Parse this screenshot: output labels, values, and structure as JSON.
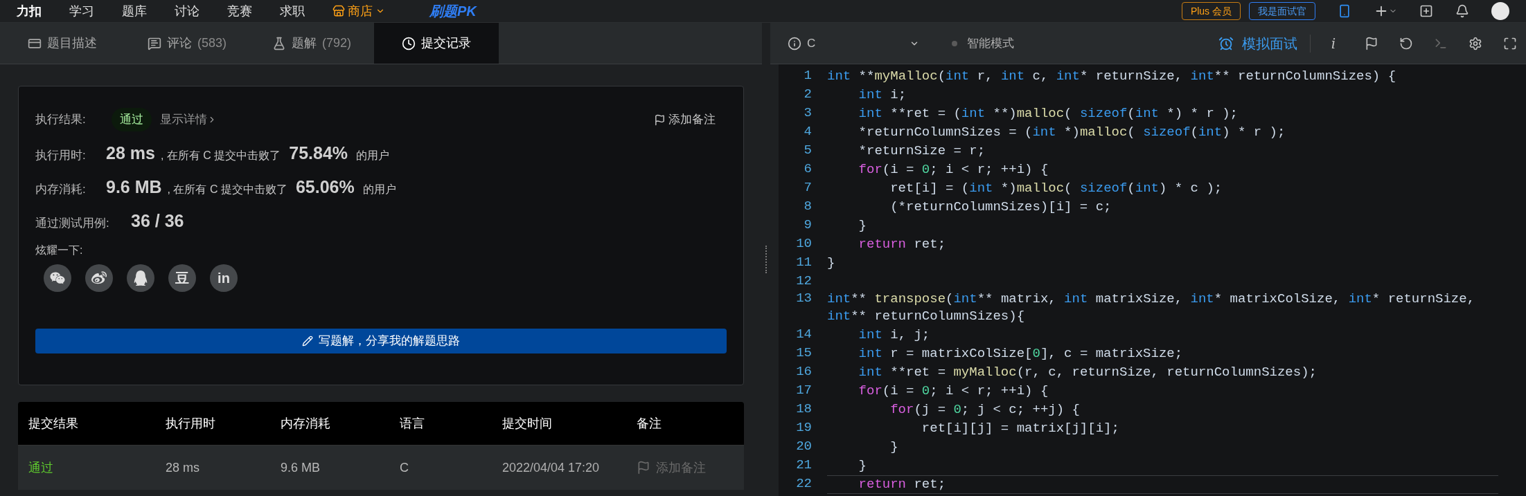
{
  "top_nav": {
    "logo": "力扣",
    "items": [
      {
        "label": "学习",
        "kind": "plain"
      },
      {
        "label": "题库",
        "kind": "plain"
      },
      {
        "label": "讨论",
        "kind": "plain"
      },
      {
        "label": "竞赛",
        "kind": "plain"
      },
      {
        "label": "求职",
        "kind": "plain"
      },
      {
        "label": "商店",
        "kind": "store"
      },
      {
        "label": "刷题PK",
        "kind": "promo"
      }
    ],
    "plus_button": "Plus 会员",
    "interviewer_button": "我是面试官"
  },
  "tabs": [
    {
      "label": "题目描述",
      "selected": false
    },
    {
      "label": "评论",
      "count": "(583)",
      "selected": false
    },
    {
      "label": "题解",
      "count": "(792)",
      "selected": false
    },
    {
      "label": "提交记录",
      "selected": true
    }
  ],
  "result_card": {
    "result_label": "执行结果:",
    "result_status": "通过",
    "details_link": "显示详情",
    "add_note": "添加备注",
    "stats": [
      {
        "label": "执行用时:",
        "value": "28 ms",
        "mid": ", 在所有 C 提交中击败了",
        "percent": "75.84%",
        "suffix": "的用户"
      },
      {
        "label": "内存消耗:",
        "value": "9.6 MB",
        "mid": ", 在所有 C 提交中击败了",
        "percent": "65.06%",
        "suffix": "的用户"
      }
    ],
    "tests_label": "通过测试用例:",
    "tests_value": "36 / 36",
    "share_label": "炫耀一下:",
    "share": [
      {
        "kind": "wechat"
      },
      {
        "kind": "weibo"
      },
      {
        "kind": "qq"
      },
      {
        "kind": "text",
        "text": "豆"
      },
      {
        "kind": "text",
        "text": "in"
      }
    ],
    "write_button": "写题解，分享我的解题思路"
  },
  "submissions": {
    "columns": [
      "提交结果",
      "执行用时",
      "内存消耗",
      "语言",
      "提交时间",
      "备注"
    ],
    "rows": [
      {
        "status": "通过",
        "kind": "accepted",
        "runtime": "28 ms",
        "memory": "9.6 MB",
        "language": "C",
        "time": "2022/04/04 17:20",
        "note": "添加备注"
      }
    ]
  },
  "editor": {
    "language": "C",
    "mode": "智能模式",
    "mock_interview": "模拟面试",
    "info_button": "i",
    "lines": [
      {
        "number": "1",
        "segments": [
          {
            "kind": "kw",
            "text": "int"
          },
          {
            "kind": "p",
            "text": " **"
          },
          {
            "kind": "fn",
            "text": "myMalloc"
          },
          {
            "kind": "p",
            "text": "("
          },
          {
            "kind": "kw",
            "text": "int"
          },
          {
            "kind": "p",
            "text": " r, "
          },
          {
            "kind": "kw",
            "text": "int"
          },
          {
            "kind": "p",
            "text": " c, "
          },
          {
            "kind": "kw",
            "text": "int"
          },
          {
            "kind": "p",
            "text": "* returnSize, "
          },
          {
            "kind": "kw",
            "text": "int"
          },
          {
            "kind": "p",
            "text": "** returnColumnSizes) {"
          }
        ]
      },
      {
        "number": "2",
        "segments": [
          {
            "kind": "kw",
            "text": "    int"
          },
          {
            "kind": "p",
            "text": " i;"
          }
        ]
      },
      {
        "number": "3",
        "segments": [
          {
            "kind": "kw",
            "text": "    int"
          },
          {
            "kind": "p",
            "text": " **ret = ("
          },
          {
            "kind": "kw",
            "text": "int"
          },
          {
            "kind": "p",
            "text": " **)"
          },
          {
            "kind": "fn",
            "text": "malloc"
          },
          {
            "kind": "p",
            "text": "( "
          },
          {
            "kind": "kw",
            "text": "sizeof"
          },
          {
            "kind": "p",
            "text": "("
          },
          {
            "kind": "kw",
            "text": "int"
          },
          {
            "kind": "p",
            "text": " *) * r );"
          }
        ]
      },
      {
        "number": "4",
        "segments": [
          {
            "kind": "p",
            "text": "    *returnColumnSizes = ("
          },
          {
            "kind": "kw",
            "text": "int"
          },
          {
            "kind": "p",
            "text": " *)"
          },
          {
            "kind": "fn",
            "text": "malloc"
          },
          {
            "kind": "p",
            "text": "( "
          },
          {
            "kind": "kw",
            "text": "sizeof"
          },
          {
            "kind": "p",
            "text": "("
          },
          {
            "kind": "kw",
            "text": "int"
          },
          {
            "kind": "p",
            "text": ") * r );"
          }
        ]
      },
      {
        "number": "5",
        "segments": [
          {
            "kind": "p",
            "text": "    *returnSize = r;"
          }
        ]
      },
      {
        "number": "6",
        "segments": [
          {
            "kind": "ctl",
            "text": "    for"
          },
          {
            "kind": "p",
            "text": "(i = "
          },
          {
            "kind": "num",
            "text": "0"
          },
          {
            "kind": "p",
            "text": "; i < r; ++i) {"
          }
        ]
      },
      {
        "number": "7",
        "segments": [
          {
            "kind": "p",
            "text": "        ret[i] = ("
          },
          {
            "kind": "kw",
            "text": "int"
          },
          {
            "kind": "p",
            "text": " *)"
          },
          {
            "kind": "fn",
            "text": "malloc"
          },
          {
            "kind": "p",
            "text": "( "
          },
          {
            "kind": "kw",
            "text": "sizeof"
          },
          {
            "kind": "p",
            "text": "("
          },
          {
            "kind": "kw",
            "text": "int"
          },
          {
            "kind": "p",
            "text": ") * c );"
          }
        ]
      },
      {
        "number": "8",
        "segments": [
          {
            "kind": "p",
            "text": "        (*returnColumnSizes)[i] = c;"
          }
        ]
      },
      {
        "number": "9",
        "segments": [
          {
            "kind": "p",
            "text": "    }"
          }
        ]
      },
      {
        "number": "10",
        "segments": [
          {
            "kind": "ctl",
            "text": "    return"
          },
          {
            "kind": "p",
            "text": " ret;"
          }
        ]
      },
      {
        "number": "11",
        "segments": [
          {
            "kind": "p",
            "text": "}"
          }
        ]
      },
      {
        "number": "12"
      },
      {
        "number": "13",
        "segments": [
          {
            "kind": "kw",
            "text": "int"
          },
          {
            "kind": "p",
            "text": "** "
          },
          {
            "kind": "fn",
            "text": "transpose"
          },
          {
            "kind": "p",
            "text": "("
          },
          {
            "kind": "kw",
            "text": "int"
          },
          {
            "kind": "p",
            "text": "** matrix, "
          },
          {
            "kind": "kw",
            "text": "int"
          },
          {
            "kind": "p",
            "text": " matrixSize, "
          },
          {
            "kind": "kw",
            "text": "int"
          },
          {
            "kind": "p",
            "text": "* matrixColSize, "
          },
          {
            "kind": "kw",
            "text": "int"
          },
          {
            "kind": "p",
            "text": "* returnSize, "
          },
          {
            "kind": "kw",
            "text": "int"
          },
          {
            "kind": "p",
            "text": "** returnColumnSizes){"
          }
        ]
      },
      {
        "number": "14",
        "segments": [
          {
            "kind": "kw",
            "text": "    int"
          },
          {
            "kind": "p",
            "text": " i, j;"
          }
        ]
      },
      {
        "number": "15",
        "segments": [
          {
            "kind": "kw",
            "text": "    int"
          },
          {
            "kind": "p",
            "text": " r = matrixColSize["
          },
          {
            "kind": "num",
            "text": "0"
          },
          {
            "kind": "p",
            "text": "], c = matrixSize;"
          }
        ]
      },
      {
        "number": "16",
        "segments": [
          {
            "kind": "kw",
            "text": "    int"
          },
          {
            "kind": "p",
            "text": " **ret = "
          },
          {
            "kind": "fn",
            "text": "myMalloc"
          },
          {
            "kind": "p",
            "text": "(r, c, returnSize, returnColumnSizes);"
          }
        ]
      },
      {
        "number": "17",
        "segments": [
          {
            "kind": "ctl",
            "text": "    for"
          },
          {
            "kind": "p",
            "text": "(i = "
          },
          {
            "kind": "num",
            "text": "0"
          },
          {
            "kind": "p",
            "text": "; i < r; ++i) {"
          }
        ]
      },
      {
        "number": "18",
        "segments": [
          {
            "kind": "ctl",
            "text": "        for"
          },
          {
            "kind": "p",
            "text": "(j = "
          },
          {
            "kind": "num",
            "text": "0"
          },
          {
            "kind": "p",
            "text": "; j < c; ++j) {"
          }
        ]
      },
      {
        "number": "19",
        "segments": [
          {
            "kind": "p",
            "text": "            ret[i][j] = matrix[j][i];"
          }
        ]
      },
      {
        "number": "20",
        "segments": [
          {
            "kind": "p",
            "text": "        }"
          }
        ]
      },
      {
        "number": "21",
        "segments": [
          {
            "kind": "p",
            "text": "    }"
          }
        ]
      },
      {
        "number": "22",
        "current": true,
        "segments": [
          {
            "kind": "ctl",
            "text": "    return"
          },
          {
            "kind": "p",
            "text": " ret;"
          }
        ]
      }
    ]
  }
}
